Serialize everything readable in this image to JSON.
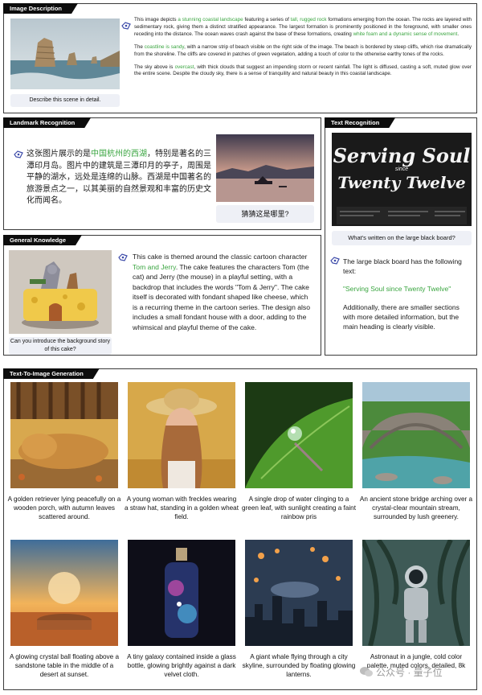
{
  "sections": {
    "image_description": "Image Description",
    "landmark": "Landmark Recognition",
    "text_recognition": "Text Recognition",
    "general_knowledge": "General Knowledge",
    "t2i": "Text-To-Image Generation"
  },
  "desc": {
    "question": "Describe this scene in detail.",
    "p1_a": "This image depicts ",
    "p1_h1": "a stunning coastal landscape",
    "p1_b": " featuring a series of ",
    "p1_h2": "tall, rugged rock",
    "p1_c": " formations emerging from the ocean. The rocks are layered with sedimentary rock, giving them a distinct stratified appearance. The largest formation is prominently positioned in the foreground, with smaller ones receding into the distance. The ocean waves crash against the base of these formations, creating ",
    "p1_h3": "white foam and a dynamic sense of movement",
    "p1_d": ".",
    "p2_a": "The ",
    "p2_h1": "coastline is sandy",
    "p2_b": ", with a narrow strip of beach visible on the right side of the image. The beach is bordered by steep cliffs, which rise dramatically from the shoreline. The cliffs are covered in patches of green vegetation, adding a touch of color to the otherwise earthy tones of the rocks.",
    "p3_a": "The sky above is ",
    "p3_h1": "overcast",
    "p3_b": ", with thick clouds that suggest an impending storm or recent rainfall. The light is diffused, casting a soft, muted glow over the entire scene. Despite the cloudy sky, there is a sense of tranquility and natural beauty in this coastal landscape."
  },
  "landmark": {
    "a1": "这张图片展示的是",
    "h1": "中国杭州的西湖",
    "a2": "，特别是著名的三潭印月岛。图片中的建筑是三潭印月的亭子，周围是平静的湖水，远处是连绵的山脉。西湖是中国著名的旅游景点之一，以其美丽的自然景观和丰富的历史文化而闻名。",
    "question": "猜猜这是哪里?"
  },
  "textrec": {
    "question": "What's written on the large black board?",
    "a1": "The large black board has the following text:",
    "quote": "\"Serving Soul since Twenty Twelve\"",
    "a2": "Additionally, there are smaller sections with more detailed information, but the main heading is clearly visible.",
    "sign_line1": "Serving Soul",
    "sign_small": "since",
    "sign_line2": "Twenty Twelve"
  },
  "general": {
    "question": "Can you introduce the background story of this cake?",
    "a": "This cake is themed around the classic cartoon character ",
    "h": "Tom and Jerry",
    "b": ". The cake features the characters Tom (the cat) and Jerry (the mouse) in a playful setting, with a backdrop that includes the words \"Tom & Jerry\". The cake itself is decorated with fondant shaped like cheese, which is a recurring theme in the cartoon series. The design also includes a small fondant house with a door, adding to the whimsical and playful theme of the cake."
  },
  "t2i": {
    "captions": [
      "A golden retriever lying peacefully on a wooden porch, with autumn leaves scattered around.",
      "A young woman with freckles wearing a straw hat, standing in a golden wheat field.",
      "A single drop of water clinging to a green leaf, with sunlight creating a faint rainbow pris",
      "An ancient stone bridge arching over a crystal-clear mountain stream, surrounded by lush greenery.",
      "A glowing crystal ball floating above a sandstone table in the middle of a desert at sunset.",
      "A tiny galaxy contained inside a glass bottle, glowing brightly against a dark velvet cloth.",
      "A giant whale flying through a city skyline, surrounded by floating glowing lanterns.",
      "Astronaut in a jungle, cold color palette, muted colors, detailed, 8k"
    ]
  },
  "watermark": "公众号 · 量子位",
  "colors": {
    "highlight": "#3aa540",
    "bubble": "#eef0f6",
    "tab": "#0d0d0d"
  }
}
